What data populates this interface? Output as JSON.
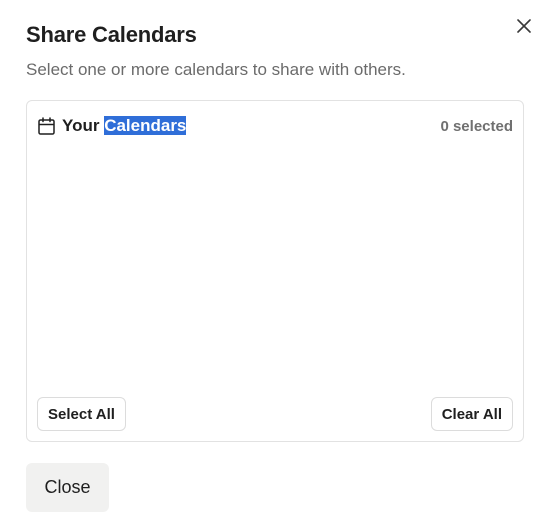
{
  "dialog": {
    "title": "Share Calendars",
    "subtitle": "Select one or more calendars to share with others.",
    "close_icon": "close-x-icon"
  },
  "panel": {
    "heading_prefix": "Your ",
    "heading_highlight": "Calendars",
    "heading_icon": "calendar-icon",
    "selected_count": "0 selected",
    "select_all_label": "Select All",
    "clear_all_label": "Clear All"
  },
  "footer": {
    "close_label": "Close"
  },
  "colors": {
    "text": "#1f1f1f",
    "muted": "#6b6b6b",
    "selection": "#2f6ed8",
    "border": "#e2e2e2",
    "close_button_bg": "#f1f1f0"
  }
}
